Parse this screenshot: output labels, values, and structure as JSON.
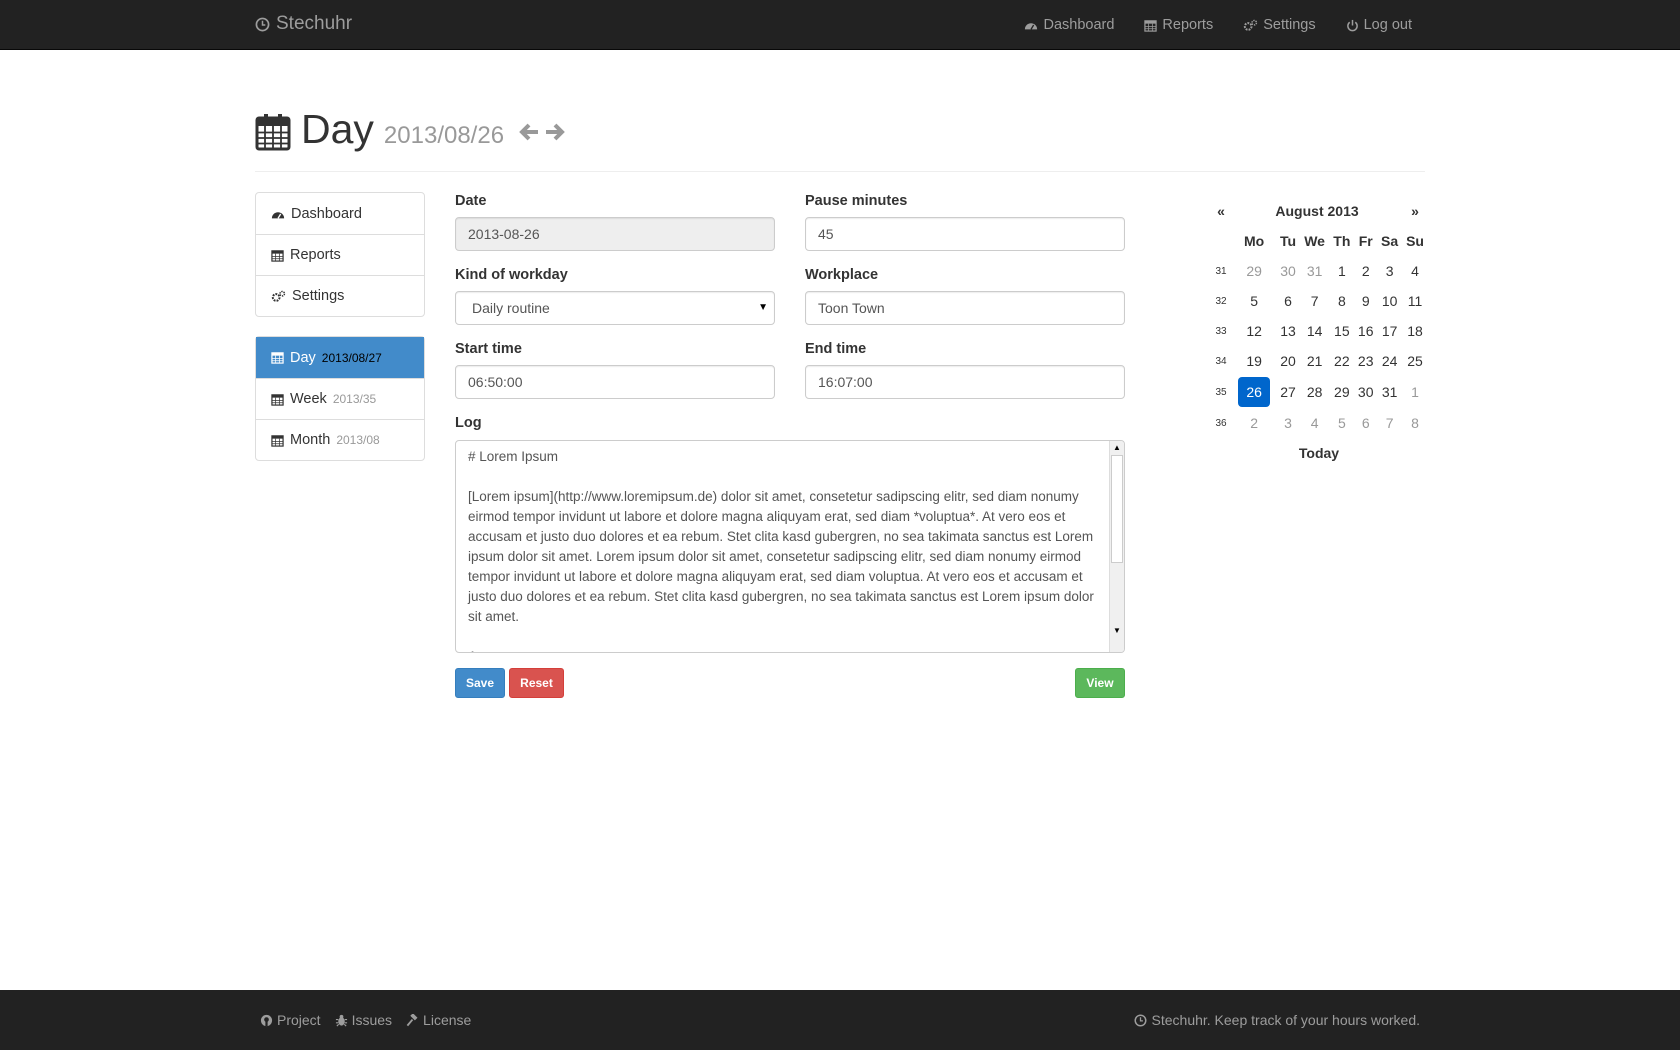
{
  "app": {
    "brand": "Stechuhr"
  },
  "nav": {
    "dashboard": "Dashboard",
    "reports": "Reports",
    "settings": "Settings",
    "logout": "Log out"
  },
  "header": {
    "title": "Day",
    "date": "2013/08/26"
  },
  "sidebar": {
    "menu": [
      "Dashboard",
      "Reports",
      "Settings"
    ],
    "views": [
      {
        "label": "Day",
        "sub": "2013/08/27"
      },
      {
        "label": "Week",
        "sub": "2013/35"
      },
      {
        "label": "Month",
        "sub": "2013/08"
      }
    ]
  },
  "form": {
    "date_label": "Date",
    "date_value": "2013-08-26",
    "pause_label": "Pause minutes",
    "pause_value": "45",
    "kind_label": "Kind of workday",
    "kind_value": "Daily routine",
    "workplace_label": "Workplace",
    "workplace_value": "Toon Town",
    "start_label": "Start time",
    "start_value": "06:50:00",
    "end_label": "End time",
    "end_value": "16:07:00",
    "log_label": "Log",
    "log_value": "# Lorem Ipsum\n\n[Lorem ipsum](http://www.loremipsum.de) dolor sit amet, consetetur sadipscing elitr, sed diam nonumy eirmod tempor invidunt ut labore et dolore magna aliquyam erat, sed diam *voluptua*. At vero eos et accusam et justo duo dolores et ea rebum. Stet clita kasd gubergren, no sea takimata sanctus est Lorem ipsum dolor sit amet. Lorem ipsum dolor sit amet, consetetur sadipscing elitr, sed diam nonumy eirmod tempor invidunt ut labore et dolore magna aliquyam erat, sed diam voluptua. At vero eos et accusam et justo duo dolores et ea rebum. Stet clita kasd gubergren, no sea takimata sanctus est Lorem ipsum dolor sit amet.\n\nAt vero eos"
  },
  "buttons": {
    "save": "Save",
    "reset": "Reset",
    "view": "View"
  },
  "calendar": {
    "prev": "«",
    "next": "»",
    "month": "August 2013",
    "weekdays": [
      "Mo",
      "Tu",
      "We",
      "Th",
      "Fr",
      "Sa",
      "Su"
    ],
    "weeks": [
      {
        "wk": "31",
        "days": [
          "29",
          "30",
          "31",
          "1",
          "2",
          "3",
          "4"
        ]
      },
      {
        "wk": "32",
        "days": [
          "5",
          "6",
          "7",
          "8",
          "9",
          "10",
          "11"
        ]
      },
      {
        "wk": "33",
        "days": [
          "12",
          "13",
          "14",
          "15",
          "16",
          "17",
          "18"
        ]
      },
      {
        "wk": "34",
        "days": [
          "19",
          "20",
          "21",
          "22",
          "23",
          "24",
          "25"
        ]
      },
      {
        "wk": "35",
        "days": [
          "26",
          "27",
          "28",
          "29",
          "30",
          "31",
          "1"
        ]
      },
      {
        "wk": "36",
        "days": [
          "2",
          "3",
          "4",
          "5",
          "6",
          "7",
          "8"
        ]
      }
    ],
    "selected": "26",
    "today": "Today"
  },
  "footer": {
    "project": "Project",
    "issues": "Issues",
    "license": "License",
    "tagline": "Stechuhr. Keep track of your hours worked."
  }
}
